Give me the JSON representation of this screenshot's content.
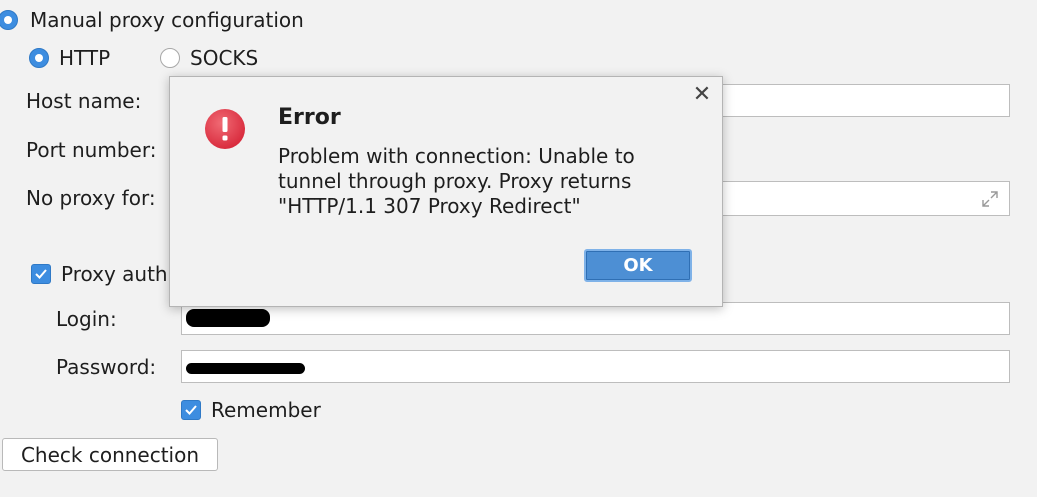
{
  "settings": {
    "manual_proxy_label": "Manual proxy configuration",
    "http_label": "HTTP",
    "socks_label": "SOCKS",
    "host_name_label": "Host name:",
    "port_number_label": "Port number:",
    "no_proxy_label": "No proxy for:",
    "proxy_auth_label": "Proxy auth",
    "login_label": "Login:",
    "password_label": "Password:",
    "remember_label": "Remember",
    "check_connection_label": "Check connection",
    "http_selected": true,
    "proxy_auth_checked": true,
    "remember_checked": true
  },
  "dialog": {
    "title": "Error",
    "message": "Problem with connection: Unable to\ntunnel through proxy. Proxy returns\n\"HTTP/1.1 307 Proxy Redirect\"",
    "ok_label": "OK",
    "close_icon": "close-icon",
    "status_icon": "error-icon"
  },
  "colors": {
    "accent": "#3d8de0",
    "error_red": "#e03c4c",
    "ok_button": "#4d8fd4"
  }
}
